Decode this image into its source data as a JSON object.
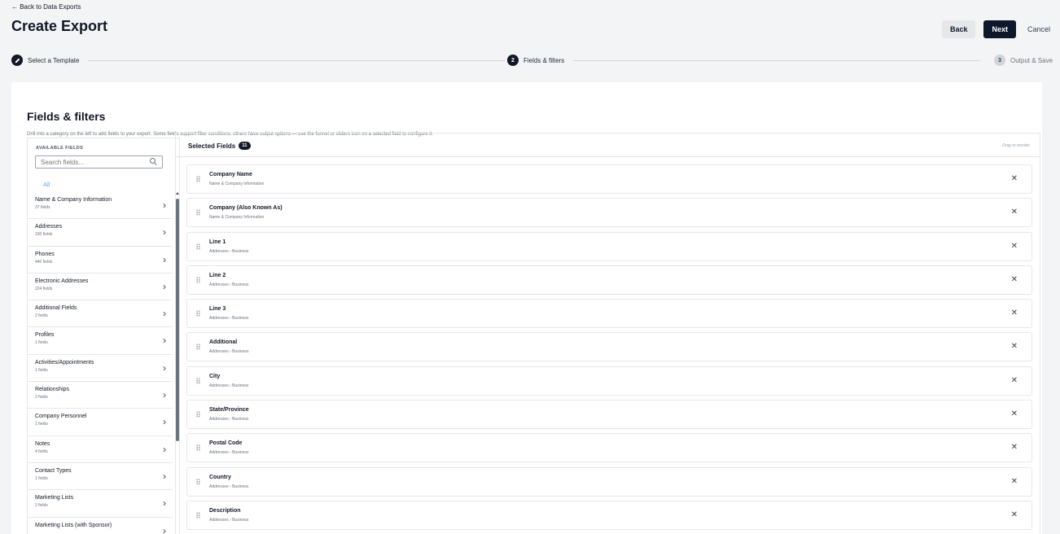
{
  "nav": {
    "back_link": "← Back to Data Exports"
  },
  "page": {
    "title": "Create Export"
  },
  "actions": {
    "back": "Back",
    "next": "Next",
    "cancel": "Cancel"
  },
  "stepper": {
    "step1": {
      "label": "Select a Template",
      "icon": "pencil-icon"
    },
    "step2": {
      "number": "2",
      "label": "Fields & filters"
    },
    "step3": {
      "number": "3",
      "label": "Output & Save"
    }
  },
  "section": {
    "title": "Fields & filters",
    "description": "Drill into a category on the left to add fields to your export. Some fields support filter conditions, others have output options — use the funnel or sliders icon on a selected field to configure it."
  },
  "available": {
    "header": "AVAILABLE FIELDS",
    "search_placeholder": "Search fields...",
    "all_tab": "All",
    "categories": [
      {
        "name": "Name & Company Information",
        "count": "37 fields"
      },
      {
        "name": "Addresses",
        "count": "190 fields"
      },
      {
        "name": "Phones",
        "count": "440 fields"
      },
      {
        "name": "Electronic Addresses",
        "count": "224 fields"
      },
      {
        "name": "Additional Fields",
        "count": "2 fields"
      },
      {
        "name": "Profiles",
        "count": "1 fields"
      },
      {
        "name": "Activities/Appointments",
        "count": "1 fields"
      },
      {
        "name": "Relationships",
        "count": "2 fields"
      },
      {
        "name": "Company Personnel",
        "count": "1 fields"
      },
      {
        "name": "Notes",
        "count": "4 fields"
      },
      {
        "name": "Contact Types",
        "count": "1 fields"
      },
      {
        "name": "Marketing Lists",
        "count": "2 fields"
      },
      {
        "name": "Marketing Lists (with Sponsor)",
        "count": ""
      }
    ]
  },
  "selected": {
    "title": "Selected Fields",
    "count": "11",
    "drag_hint": "Drag to reorder",
    "fields": [
      {
        "name": "Company Name",
        "path": "Name & Company Information"
      },
      {
        "name": "Company (Also Known As)",
        "path": "Name & Company Information"
      },
      {
        "name": "Line 1",
        "path": "Addresses › Business"
      },
      {
        "name": "Line 2",
        "path": "Addresses › Business"
      },
      {
        "name": "Line 3",
        "path": "Addresses › Business"
      },
      {
        "name": "Additional",
        "path": "Addresses › Business"
      },
      {
        "name": "City",
        "path": "Addresses › Business"
      },
      {
        "name": "State/Province",
        "path": "Addresses › Business"
      },
      {
        "name": "Postal Code",
        "path": "Addresses › Business"
      },
      {
        "name": "Country",
        "path": "Addresses › Business"
      },
      {
        "name": "Description",
        "path": "Addresses › Business"
      }
    ]
  }
}
